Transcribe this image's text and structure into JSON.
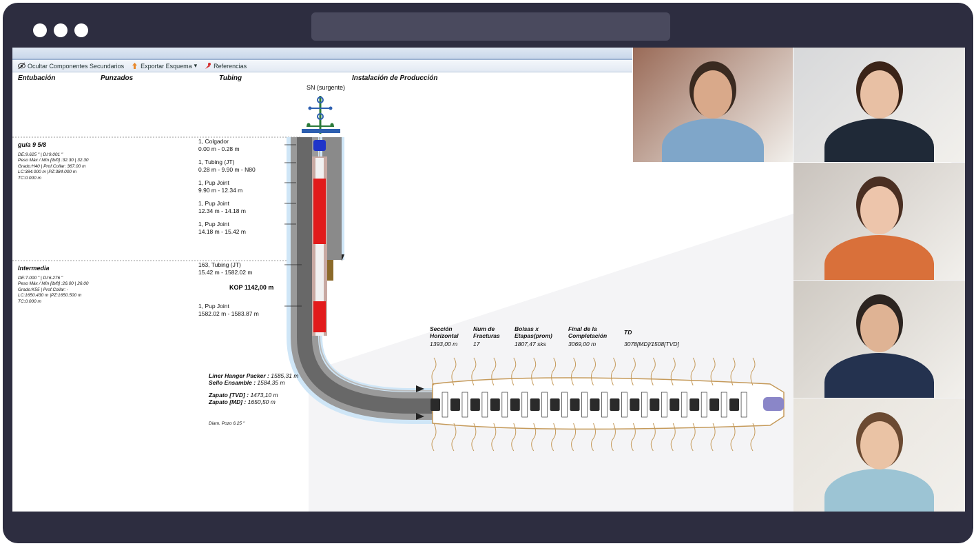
{
  "toolbar": {
    "hide_label": "Ocultar Componentes Secundarios",
    "export_label": "Exportar Esquema",
    "refs_label": "Referencias"
  },
  "headers": {
    "entubacion": "Entubación",
    "punzados": "Punzados",
    "tubing": "Tubing",
    "instalacion": "Instalación de Producción"
  },
  "wellhead_label": "SN (surgente)",
  "casings": [
    {
      "title": "guía 9 5/8",
      "lines": [
        "DE:9.625 \" | DI:9.001 \"",
        "Peso Máx / Mín [lb/ft] :32.30 | 32.30",
        "Grado:H40 | Prof.Collar: 367.00 m",
        "LC:384.000 m |PZ:384.000 m",
        "TC:0.000 m"
      ]
    },
    {
      "title": "Intermedia",
      "lines": [
        "DE:7.000 \" | DI:6.276 \"",
        "Peso Máx / Mín [lb/ft] :26.00 | 26.00",
        "Grado:K55 | Prof.Collar: -",
        "LC:1650.430 m |PZ:1650.500 m",
        "TC:0.000 m"
      ]
    }
  ],
  "components": [
    {
      "name": "1, Colgador",
      "range": "0.00 m - 0.28 m"
    },
    {
      "name": "1, Tubing (JT)",
      "range": "0.28 m - 9.90 m - N80"
    },
    {
      "name": "1, Pup Joint",
      "range": "9.90 m - 12.34 m"
    },
    {
      "name": "1, Pup Joint",
      "range": "12.34 m - 14.18 m"
    },
    {
      "name": "1, Pup Joint",
      "range": "14.18 m - 15.42 m"
    },
    {
      "name": "163, Tubing (JT)",
      "range": "15.42 m - 1582.02 m"
    },
    {
      "name": "1, Pup Joint",
      "range": "1582.02 m - 1583.87 m"
    }
  ],
  "kop": "KOP 1142,00 m",
  "horizontal_info": [
    {
      "label": "Sección Horizontal",
      "value": "1393,00 m"
    },
    {
      "label": "Num de Fracturas",
      "value": "17"
    },
    {
      "label": "Bolsas x Etapas(prom)",
      "value": "1807,47 sks"
    },
    {
      "label": "Final de la Completación",
      "value": "3069,00 m"
    },
    {
      "label": "TD",
      "value": "3078[MD]/1508[TVD]"
    }
  ],
  "bottom": {
    "packer_label": "Liner Hanger Packer :",
    "packer_value": "1585,31 m",
    "seal_label": "Sello Ensamble :",
    "seal_value": "1584,35 m",
    "shoe_tvd_label": "Zapato [TVD] :",
    "shoe_tvd_value": "1473,10 m",
    "shoe_md_label": "Zapato [MD] :",
    "shoe_md_value": "1650,50 m",
    "diam": "Diam. Pozo 6.25 \""
  },
  "colors": {
    "frame": "#2d2d40",
    "tubing_red": "#e21b1b",
    "pipe_gray": "#7a7a7a",
    "casing_blue": "#cfe6f7"
  },
  "participants": [
    {
      "name": "man-glasses",
      "bg": "#9a6b58",
      "shirt": "#7fa6c9",
      "skin": "#d9a98a",
      "hair": "#3a2a20"
    },
    {
      "name": "woman-smiling",
      "bg": "#d7d8da",
      "shirt": "#1f2937",
      "skin": "#e8c0a4",
      "hair": "#3b2418"
    },
    {
      "name": "woman-orange",
      "bg": "#c9c3bd",
      "shirt": "#d9703a",
      "skin": "#edc5ab",
      "hair": "#4a2f22"
    },
    {
      "name": "man-suit",
      "bg": "#cfcac3",
      "shirt": "#24324f",
      "skin": "#dfb394",
      "hair": "#2c2420"
    },
    {
      "name": "woman-headset",
      "bg": "#e7e3dc",
      "shirt": "#9cc4d4",
      "skin": "#eac3a5",
      "hair": "#6b4a32"
    }
  ]
}
